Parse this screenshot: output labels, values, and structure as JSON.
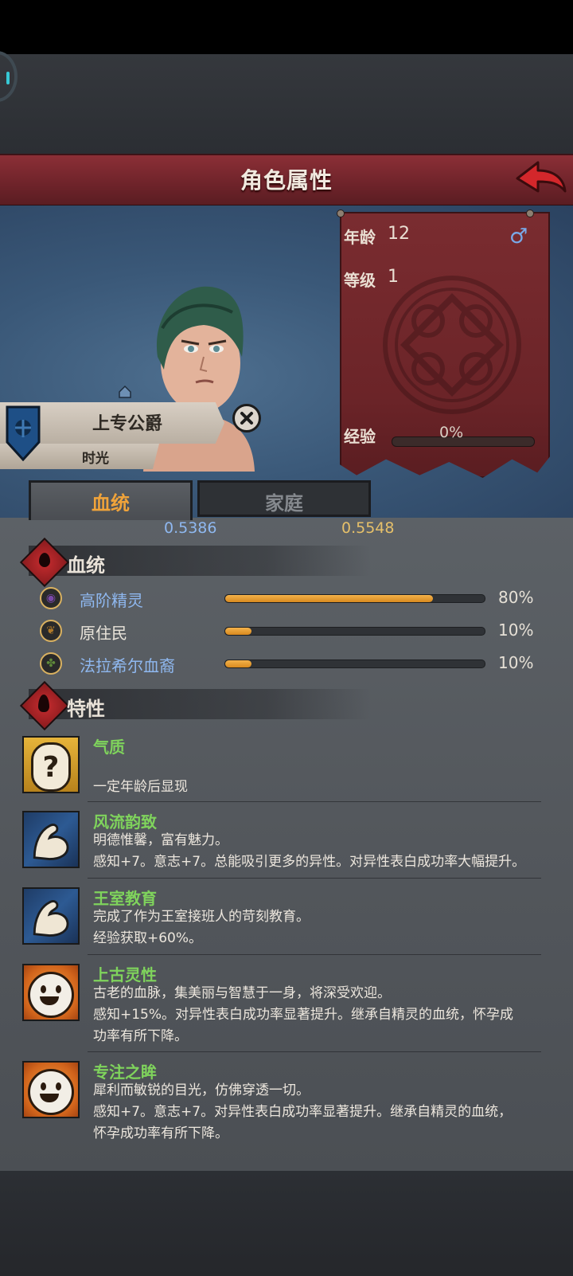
{
  "header": {
    "title": "角色属性"
  },
  "stats": {
    "age_label": "年龄",
    "age_value": "12",
    "level_label": "等级",
    "level_value": "1",
    "exp_label": "经验",
    "exp_value": "0%",
    "gender_symbol": "♂"
  },
  "character": {
    "rank_title": "上专公爵",
    "rank_sub": "时光"
  },
  "tabs": [
    {
      "label": "血统"
    },
    {
      "label": "家庭"
    }
  ],
  "values": {
    "left": "0.5386",
    "right": "0.5548"
  },
  "bloodline": {
    "title": "血统",
    "items": [
      {
        "name": "高阶精灵",
        "percent": "80%",
        "fraction": 0.8,
        "icon": "high-elf-icon",
        "name_color": "#8fb8f0"
      },
      {
        "name": "原住民",
        "percent": "10%",
        "fraction": 0.1,
        "icon": "leaf-icon",
        "name_color": "#e9e4da"
      },
      {
        "name": "法拉希尔血裔",
        "percent": "10%",
        "fraction": 0.1,
        "icon": "tree-icon",
        "name_color": "#8fb8f0"
      }
    ]
  },
  "traits": {
    "title": "特性",
    "items": [
      {
        "name": "气质",
        "icon": "question-mark-icon",
        "lines": [
          "",
          "一定年龄后显现"
        ]
      },
      {
        "name": "风流韵致",
        "icon": "flexed-arm-icon",
        "lines": [
          "明德惟馨，富有魅力。",
          "感知+7。意志+7。总能吸引更多的异性。对异性表白成功率大幅提升。"
        ]
      },
      {
        "name": "王室教育",
        "icon": "flexed-arm-icon",
        "lines": [
          "完成了作为王室接班人的苛刻教育。",
          "经验获取+60%。"
        ]
      },
      {
        "name": "上古灵性",
        "icon": "smiley-face-icon",
        "lines": [
          "古老的血脉，集美丽与智慧于一身，将深受欢迎。",
          "感知+15%。对异性表白成功率显著提升。继承自精灵的血统，怀孕成",
          "功率有所下降。"
        ]
      },
      {
        "name": "专注之眸",
        "icon": "smiley-face-icon",
        "lines": [
          "犀利而敏锐的目光，仿佛穿透一切。",
          "感知+7。意志+7。对异性表白成功率显著提升。继承自精灵的血统，",
          "怀孕成功率有所下降。"
        ]
      }
    ]
  },
  "colors": {
    "accent_red": "#7a2c30",
    "bar_orange": "#f0a33a",
    "trait_green": "#7fd35c"
  }
}
